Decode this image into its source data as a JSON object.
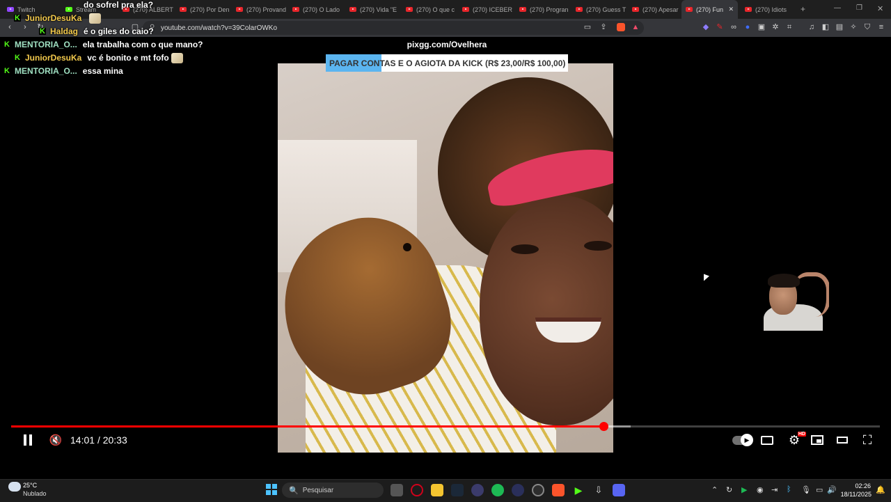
{
  "browser": {
    "tabs": [
      {
        "label": "Twitch",
        "type": "twitch"
      },
      {
        "label": "Stream",
        "type": "kick"
      },
      {
        "label": "(270) ALBERT",
        "type": "youtube"
      },
      {
        "label": "(270) Por Den",
        "type": "youtube"
      },
      {
        "label": "(270) Provand",
        "type": "youtube"
      },
      {
        "label": "(270) O Lado",
        "type": "youtube"
      },
      {
        "label": "(270) Vida \"E",
        "type": "youtube"
      },
      {
        "label": "(270) O que c",
        "type": "youtube"
      },
      {
        "label": "(270) ICEBER",
        "type": "youtube"
      },
      {
        "label": "(270) Progran",
        "type": "youtube"
      },
      {
        "label": "(270) Guess T",
        "type": "youtube"
      },
      {
        "label": "(270) Apesar",
        "type": "youtube"
      },
      {
        "label": "(270) Fun",
        "type": "youtube",
        "active": true
      },
      {
        "label": "(270) Idiots",
        "type": "youtube"
      }
    ],
    "new_tab": "+",
    "url": "youtube.com/watch?v=39ColarOWKo"
  },
  "chat": [
    {
      "user": "",
      "message": "do sofrel pra ela?",
      "badge": false,
      "user_color": "#ffffff"
    },
    {
      "user": "JuniorDesuKa",
      "message": "",
      "badge": true,
      "emote": true,
      "user_color": "#f2c94c"
    },
    {
      "user": "Haldag",
      "message": "é o giles do caio?",
      "badge": true,
      "user_color": "#f2c94c"
    },
    {
      "user": "MENTORIA_O...",
      "message": "ela trabalha com o que mano?",
      "badge": true,
      "user_color": "#9fe0c2"
    },
    {
      "user": "JuniorDesuKa",
      "message": "vc é bonito e mt fofo",
      "badge": true,
      "emote": true,
      "user_color": "#f2c94c"
    },
    {
      "user": "MENTORIA_O...",
      "message": "essa mina",
      "badge": true,
      "user_color": "#9fe0c2"
    }
  ],
  "overlay": {
    "pix_link": "pixgg.com/Ovelhera",
    "goal_text": "PAGAR CONTAS E O AGIOTA DA KICK (R$ 23,00/R$ 100,00)",
    "goal_progress": 0.23
  },
  "player": {
    "current_time": "14:01",
    "separator": "/",
    "duration": "20:33",
    "played_fraction": 0.682,
    "buffered_fraction": 0.713,
    "hd_badge": "HD",
    "colors": {
      "played": "#ff0000",
      "goal_fill": "#5bb5f0"
    }
  },
  "taskbar": {
    "weather_temp": "25°C",
    "weather_condition": "Nublado",
    "search_placeholder": "Pesquisar",
    "time": "02:26",
    "date": "18/11/2025"
  },
  "icons": {
    "chat_badge": "K",
    "mute": "🔇",
    "settings": "⚙",
    "fullscreen": "⛶",
    "search": "🔍"
  }
}
